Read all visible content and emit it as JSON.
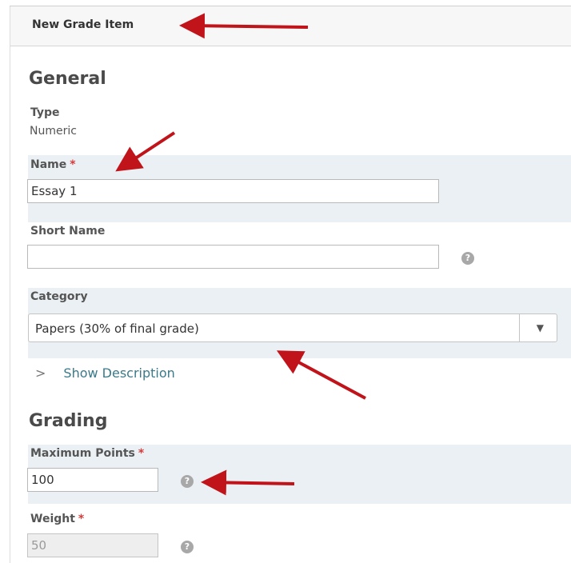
{
  "header": {
    "title": "New Grade Item"
  },
  "general": {
    "heading": "General",
    "type_label": "Type",
    "type_value": "Numeric",
    "name_label": "Name",
    "name_required": "*",
    "name_value": "Essay 1",
    "short_name_label": "Short Name",
    "short_name_value": "",
    "help_glyph": "?",
    "category_label": "Category",
    "category_value": "Papers (30% of final grade)",
    "show_description": "Show Description"
  },
  "grading": {
    "heading": "Grading",
    "max_points_label": "Maximum Points",
    "max_points_required": "*",
    "max_points_value": "100",
    "weight_label": "Weight",
    "weight_required": "*",
    "weight_value": "50"
  },
  "icons": {
    "help": "help-circle-icon",
    "dropdown": "caret-down-icon",
    "expand": "chevron-right-icon",
    "annotation": "red-arrow-annotation"
  },
  "colors": {
    "required": "#d63b3b",
    "field_band": "#eaf0f3",
    "link": "#3a7a8a",
    "arrow": "#c0141a"
  }
}
